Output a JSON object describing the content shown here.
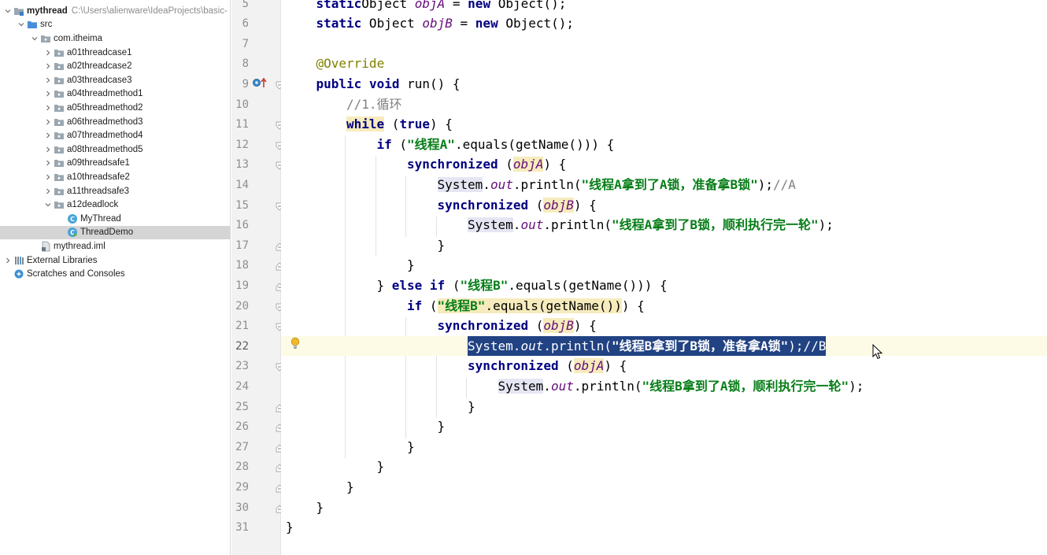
{
  "project_tree": {
    "items": [
      {
        "label": "mythread",
        "path": "C:\\Users\\alienware\\IdeaProjects\\basic-",
        "indent": 0,
        "arrow": "down",
        "icon": "module-folder",
        "bold": true
      },
      {
        "label": "src",
        "indent": 1,
        "arrow": "down",
        "icon": "source-folder"
      },
      {
        "label": "com.itheima",
        "indent": 2,
        "arrow": "down",
        "icon": "package"
      },
      {
        "label": "a01threadcase1",
        "indent": 3,
        "arrow": "right",
        "icon": "package"
      },
      {
        "label": "a02threadcase2",
        "indent": 3,
        "arrow": "right",
        "icon": "package"
      },
      {
        "label": "a03threadcase3",
        "indent": 3,
        "arrow": "right",
        "icon": "package"
      },
      {
        "label": "a04threadmethod1",
        "indent": 3,
        "arrow": "right",
        "icon": "package"
      },
      {
        "label": "a05threadmethod2",
        "indent": 3,
        "arrow": "right",
        "icon": "package"
      },
      {
        "label": "a06threadmethod3",
        "indent": 3,
        "arrow": "right",
        "icon": "package"
      },
      {
        "label": "a07threadmethod4",
        "indent": 3,
        "arrow": "right",
        "icon": "package"
      },
      {
        "label": "a08threadmethod5",
        "indent": 3,
        "arrow": "right",
        "icon": "package"
      },
      {
        "label": "a09threadsafe1",
        "indent": 3,
        "arrow": "right",
        "icon": "package"
      },
      {
        "label": "a10threadsafe2",
        "indent": 3,
        "arrow": "right",
        "icon": "package"
      },
      {
        "label": "a11threadsafe3",
        "indent": 3,
        "arrow": "right",
        "icon": "package"
      },
      {
        "label": "a12deadlock",
        "indent": 3,
        "arrow": "down",
        "icon": "package"
      },
      {
        "label": "MyThread",
        "indent": 4,
        "arrow": "none",
        "icon": "java-class"
      },
      {
        "label": "ThreadDemo",
        "indent": 4,
        "arrow": "none",
        "icon": "java-class-run",
        "selected": true
      },
      {
        "label": "mythread.iml",
        "indent": 2,
        "arrow": "none",
        "icon": "iml-file"
      },
      {
        "label": "External Libraries",
        "indent": 0,
        "arrow": "right",
        "icon": "libraries"
      },
      {
        "label": "Scratches and Consoles",
        "indent": 0,
        "arrow": "none",
        "icon": "scratches"
      }
    ]
  },
  "editor": {
    "current_line": 22,
    "lines": [
      {
        "n": 5,
        "indent": 1,
        "tokens": [
          [
            "kw",
            "static"
          ],
          [
            "",
            "Object "
          ],
          [
            "fld",
            "objA"
          ],
          [
            "",
            " = "
          ],
          [
            "kw",
            "new"
          ],
          [
            "",
            " Object();"
          ]
        ]
      },
      {
        "n": 6,
        "indent": 1,
        "tokens": [
          [
            "kw",
            "static"
          ],
          [
            "",
            " Object "
          ],
          [
            "fld",
            "objB"
          ],
          [
            "",
            " = "
          ],
          [
            "kw",
            "new"
          ],
          [
            "",
            " Object();"
          ]
        ]
      },
      {
        "n": 7,
        "indent": 0,
        "tokens": []
      },
      {
        "n": 8,
        "indent": 1,
        "tokens": [
          [
            "ann",
            "@Override"
          ]
        ]
      },
      {
        "n": 9,
        "indent": 1,
        "tokens": [
          [
            "kw",
            "public"
          ],
          [
            " ",
            ""
          ],
          [
            "kw",
            "void"
          ],
          [
            "",
            " run() {"
          ]
        ]
      },
      {
        "n": 10,
        "indent": 2,
        "tokens": [
          [
            "com",
            "//1.循环"
          ]
        ]
      },
      {
        "n": 11,
        "indent": 2,
        "tokens": [
          [
            "kw hl-word",
            "while"
          ],
          [
            "",
            " ("
          ],
          [
            "kw",
            "true"
          ],
          [
            "",
            ") {"
          ]
        ]
      },
      {
        "n": 12,
        "indent": 3,
        "tokens": [
          [
            "kw",
            "if"
          ],
          [
            "",
            " ("
          ],
          [
            "str",
            "\"线程A\""
          ],
          [
            "",
            ".equals(getName())) {"
          ]
        ]
      },
      {
        "n": 13,
        "indent": 4,
        "tokens": [
          [
            "kw",
            "synchronized"
          ],
          [
            "",
            " ("
          ],
          [
            "fld hl-word",
            "objA"
          ],
          [
            "",
            ") {"
          ]
        ]
      },
      {
        "n": 14,
        "indent": 5,
        "tokens": [
          [
            "hl-ref",
            "System"
          ],
          [
            "",
            "."
          ],
          [
            "fld",
            "out"
          ],
          [
            "",
            ".println("
          ],
          [
            "str",
            "\"线程A拿到了A锁，准备拿B锁\""
          ],
          [
            "",
            ");"
          ],
          [
            "com",
            "//A"
          ]
        ]
      },
      {
        "n": 15,
        "indent": 5,
        "tokens": [
          [
            "kw",
            "synchronized"
          ],
          [
            "",
            " ("
          ],
          [
            "fld hl-word",
            "objB"
          ],
          [
            "",
            ") {"
          ]
        ]
      },
      {
        "n": 16,
        "indent": 6,
        "tokens": [
          [
            "hl-ref",
            "System"
          ],
          [
            "",
            "."
          ],
          [
            "fld",
            "out"
          ],
          [
            "",
            ".println("
          ],
          [
            "str",
            "\"线程A拿到了B锁，顺利执行完一轮\""
          ],
          [
            "",
            ");"
          ]
        ]
      },
      {
        "n": 17,
        "indent": 5,
        "tokens": [
          [
            "",
            "}"
          ]
        ]
      },
      {
        "n": 18,
        "indent": 4,
        "tokens": [
          [
            "",
            "}"
          ]
        ]
      },
      {
        "n": 19,
        "indent": 3,
        "tokens": [
          [
            "",
            "} "
          ],
          [
            "kw",
            "else if"
          ],
          [
            "",
            " ("
          ],
          [
            "str",
            "\"线程B\""
          ],
          [
            "",
            ".equals(getName())) {"
          ]
        ]
      },
      {
        "n": 20,
        "indent": 4,
        "tokens": [
          [
            "kw",
            "if"
          ],
          [
            "",
            " ("
          ],
          [
            "str hl-word",
            "\"线程B\""
          ],
          [
            "hl-word",
            ".equals(getName())"
          ],
          [
            "",
            ") {"
          ]
        ]
      },
      {
        "n": 21,
        "indent": 5,
        "tokens": [
          [
            "kw",
            "synchronized"
          ],
          [
            "",
            " ("
          ],
          [
            "fld hl-word",
            "objB"
          ],
          [
            "",
            ") {"
          ]
        ]
      },
      {
        "n": 22,
        "indent": 6,
        "selected": true,
        "tokens": [
          [
            "",
            "System."
          ],
          [
            "fld",
            "out"
          ],
          [
            "",
            ".println("
          ],
          [
            "str",
            "\"线程B拿到了B锁，准备拿A锁\""
          ],
          [
            "",
            ");"
          ],
          [
            "com",
            "//B"
          ]
        ]
      },
      {
        "n": 23,
        "indent": 6,
        "tokens": [
          [
            "kw",
            "synchronized"
          ],
          [
            "",
            " ("
          ],
          [
            "fld hl-word",
            "objA"
          ],
          [
            "",
            ") {"
          ]
        ]
      },
      {
        "n": 24,
        "indent": 7,
        "tokens": [
          [
            "hl-ref",
            "System"
          ],
          [
            "",
            "."
          ],
          [
            "fld",
            "out"
          ],
          [
            "",
            ".println("
          ],
          [
            "str",
            "\"线程B拿到了A锁，顺利执行完一轮\""
          ],
          [
            "",
            ");"
          ]
        ]
      },
      {
        "n": 25,
        "indent": 6,
        "tokens": [
          [
            "",
            "}"
          ]
        ]
      },
      {
        "n": 26,
        "indent": 5,
        "tokens": [
          [
            "",
            "}"
          ]
        ]
      },
      {
        "n": 27,
        "indent": 4,
        "tokens": [
          [
            "",
            "}"
          ]
        ]
      },
      {
        "n": 28,
        "indent": 3,
        "tokens": [
          [
            "",
            "}"
          ]
        ]
      },
      {
        "n": 29,
        "indent": 2,
        "tokens": [
          [
            "",
            "}"
          ]
        ]
      },
      {
        "n": 30,
        "indent": 1,
        "tokens": [
          [
            "",
            "}"
          ]
        ]
      },
      {
        "n": 31,
        "indent": 0,
        "tokens": [
          [
            "",
            "}"
          ]
        ]
      }
    ]
  },
  "gutter_icons": {
    "override": "override-run-icon",
    "bulb": "lightbulb-icon"
  },
  "colors": {
    "keyword": "#000080",
    "string": "#067d17",
    "comment": "#808080",
    "annotation": "#808000",
    "field": "#660e7a",
    "selection": "#214283"
  }
}
